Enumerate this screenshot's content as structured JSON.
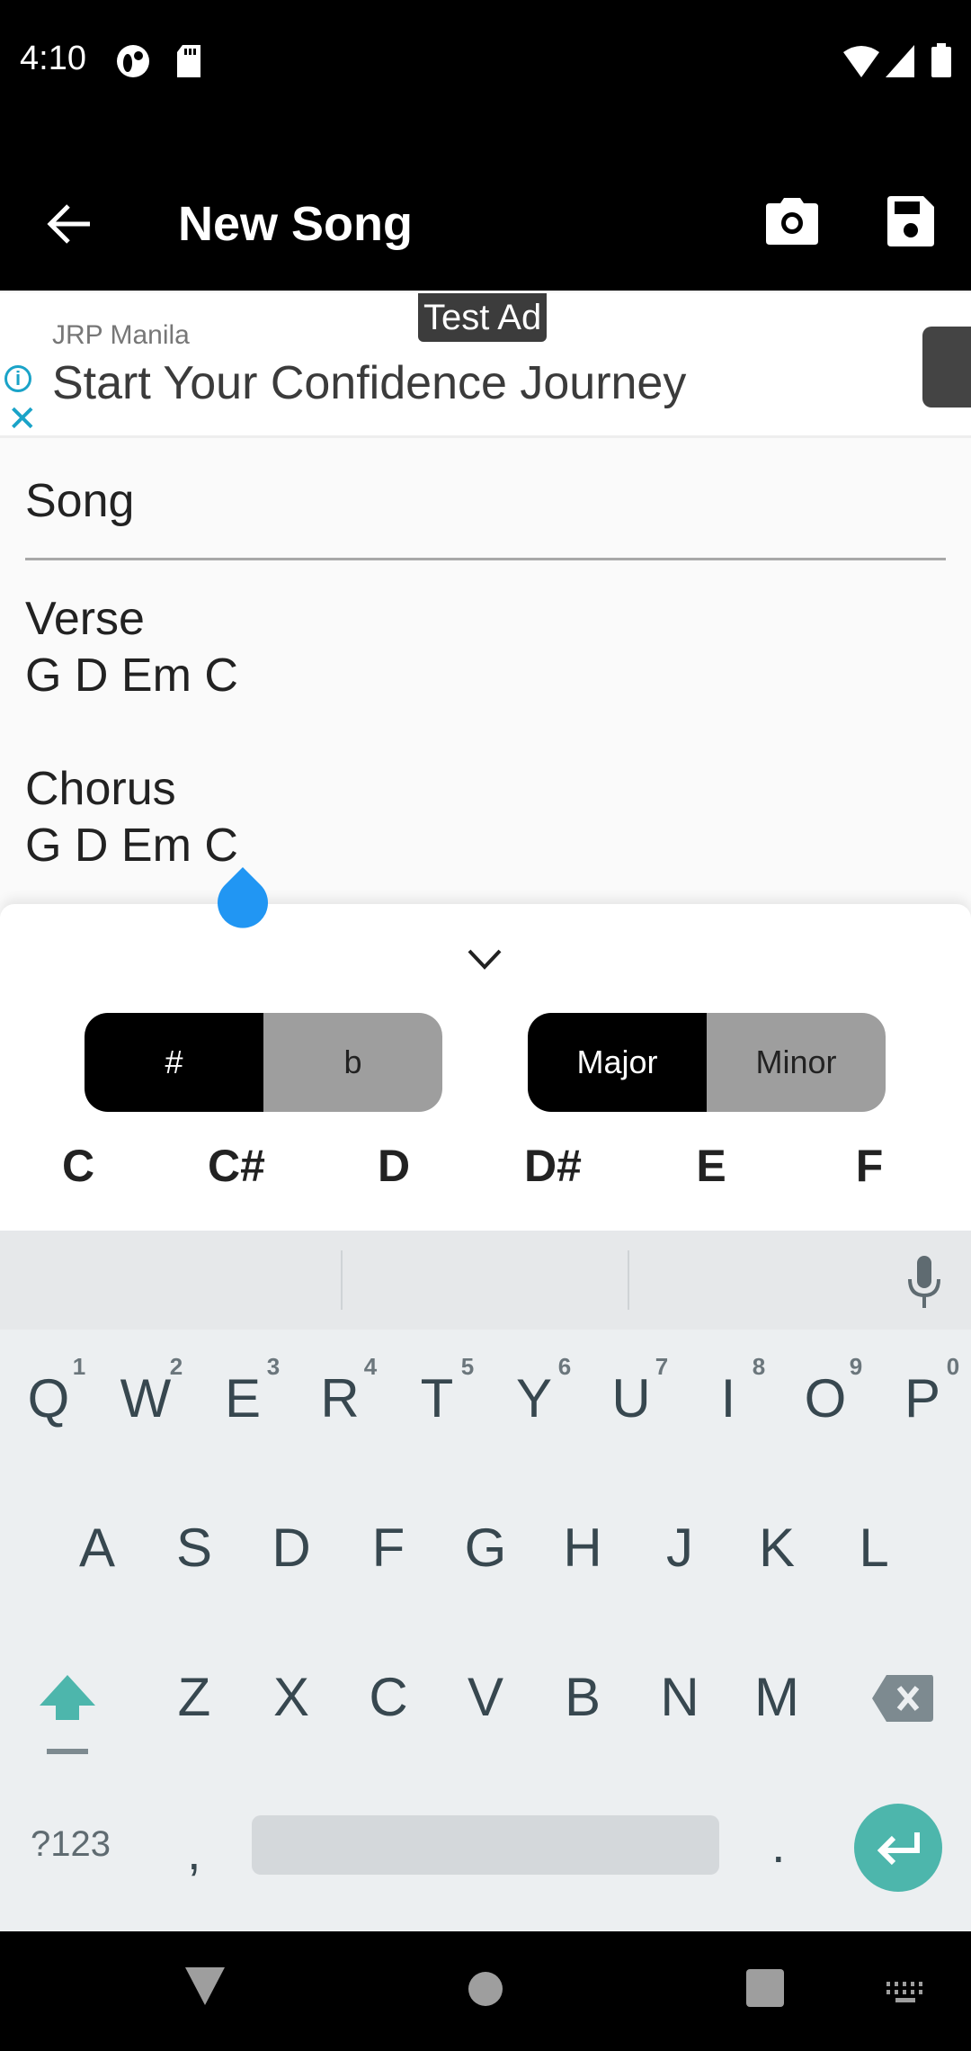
{
  "status_bar": {
    "time": "4:10",
    "left_icons": [
      "notification-app-icon",
      "sd-card-icon"
    ],
    "right_icons": [
      "wifi-icon",
      "signal-icon",
      "battery-icon"
    ]
  },
  "app_bar": {
    "title": "New Song",
    "back_icon": "arrow-back-icon",
    "actions": [
      "camera-icon",
      "save-icon"
    ]
  },
  "ad": {
    "badge": "Test Ad",
    "advertiser": "JRP Manila",
    "headline": "Start Your Confidence Journey",
    "info_glyph": "i",
    "close_glyph": "✕"
  },
  "editor": {
    "title_value": "Song",
    "lyrics": "Verse\nG D Em C\n\nChorus\nG D Em C"
  },
  "chord_panel": {
    "collapse_icon": "chevron-down-icon",
    "accidental_toggle": [
      {
        "label": "#",
        "selected": true
      },
      {
        "label": "b",
        "selected": false
      }
    ],
    "quality_toggle": [
      {
        "label": "Major",
        "selected": true
      },
      {
        "label": "Minor",
        "selected": false
      }
    ],
    "notes": [
      "C",
      "C#",
      "D",
      "D#",
      "E",
      "F"
    ]
  },
  "keyboard": {
    "row1": [
      "Q",
      "W",
      "E",
      "R",
      "T",
      "Y",
      "U",
      "I",
      "O",
      "P"
    ],
    "row1_hints": [
      "1",
      "2",
      "3",
      "4",
      "5",
      "6",
      "7",
      "8",
      "9",
      "0"
    ],
    "row2": [
      "A",
      "S",
      "D",
      "F",
      "G",
      "H",
      "J",
      "K",
      "L"
    ],
    "row3": [
      "Z",
      "X",
      "C",
      "V",
      "B",
      "N",
      "M"
    ],
    "symbols_label": "?123",
    "comma": ",",
    "period": ".",
    "accent_color": "#4db6ac"
  },
  "nav_bar": {
    "buttons": [
      "back-triangle-icon",
      "home-circle-icon",
      "recents-square-icon",
      "keyboard-switch-icon"
    ]
  }
}
